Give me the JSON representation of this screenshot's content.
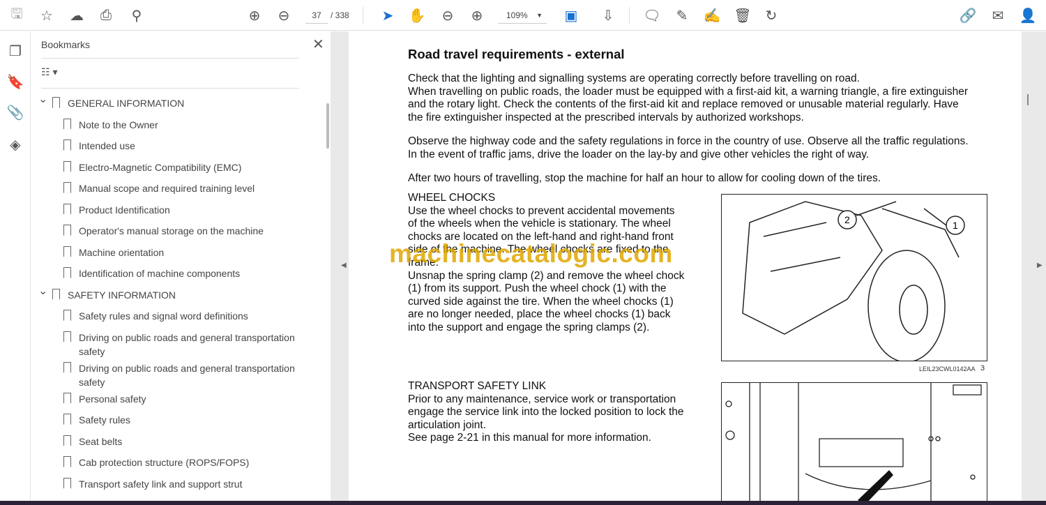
{
  "toolbar": {
    "page_current": "37",
    "page_total": "/ 338",
    "zoom": "109%",
    "icons": [
      "save-icon",
      "star-icon",
      "upload-cloud-icon",
      "print-icon",
      "search-zoom-icon",
      "page-up-icon",
      "page-down-icon",
      "select-arrow-icon",
      "hand-icon",
      "zoom-out-icon",
      "zoom-in-icon",
      "fit-page-icon",
      "scroll-mode-icon",
      "comment-icon",
      "highlight-icon",
      "sign-icon",
      "delete-icon",
      "rotate-icon",
      "share-link-icon",
      "email-icon",
      "add-user-icon"
    ]
  },
  "panel": {
    "title": "Bookmarks",
    "items": [
      {
        "label": "GENERAL INFORMATION",
        "level": 0
      },
      {
        "label": "Note to the Owner",
        "level": 1
      },
      {
        "label": "Intended use",
        "level": 1
      },
      {
        "label": "Electro-Magnetic Compatibility (EMC)",
        "level": 1
      },
      {
        "label": "Manual scope and required training level",
        "level": 1
      },
      {
        "label": "Product Identification",
        "level": 1
      },
      {
        "label": "Operator's manual storage on the machine",
        "level": 1
      },
      {
        "label": "Machine orientation",
        "level": 1
      },
      {
        "label": "Identification of machine components",
        "level": 1
      },
      {
        "label": "SAFETY INFORMATION",
        "level": 0
      },
      {
        "label": "Safety rules and signal word definitions",
        "level": 1
      },
      {
        "label": "Driving on public roads and general transportation safety",
        "level": 1
      },
      {
        "label": "Driving on public roads and general transportation safety",
        "level": 1
      },
      {
        "label": "Personal safety",
        "level": 1
      },
      {
        "label": "Safety rules",
        "level": 1
      },
      {
        "label": "Seat belts",
        "level": 1
      },
      {
        "label": "Cab protection structure (ROPS/FOPS)",
        "level": 1
      },
      {
        "label": "Transport safety link and support strut",
        "level": 1
      }
    ]
  },
  "document": {
    "title": "Road travel requirements - external",
    "p1": [
      "Check that the lighting and signalling systems are operating correctly before travelling on road.",
      "When travelling on public roads, the loader must be equipped with a first-aid kit, a warning triangle, a fire extinguisher",
      "and the rotary light.  Check the contents of the first-aid kit and replace removed or unusable material regularly.  Have",
      "the fire extinguisher inspected at the prescribed intervals by authorized workshops."
    ],
    "p2": [
      "Observe the highway code and the safety regulations in force in the country of use.  Observe all the traffic regulations.",
      "In the event of traffic jams, drive the loader on the lay-by and give other vehicles the right of way."
    ],
    "p3": "After two hours of travelling, stop the machine for half an hour to allow for cooling down of the tires.",
    "wheel_heading": "WHEEL CHOCKS",
    "wheel": [
      "Use the wheel chocks to prevent accidental movements",
      "of the wheels when the vehicle is stationary.  The wheel",
      "chocks are located on the left-hand and right-hand front",
      "side of the machine.  The wheel chocks are fixed to the",
      "frame.",
      "Unsnap the spring clamp (2) and remove the wheel chock",
      "(1) from its support.  Push the wheel chock (1) with the",
      "curved side against the tire.  When the wheel chocks (1)",
      "are no longer needed, place the wheel chocks (1) back",
      "into the support and engage the spring clamps (2)."
    ],
    "fig_code": "LEIL23CWL0142AA",
    "fig_num": "3",
    "callout1": "1",
    "callout2": "2",
    "link_heading": "TRANSPORT SAFETY LINK",
    "link": [
      "Prior to any maintenance, service work or transportation",
      "engage the service link into the locked position to lock the",
      "articulation joint.",
      "See page 2-21 in this manual for more information."
    ],
    "watermark": "machinecatalogic.com"
  }
}
